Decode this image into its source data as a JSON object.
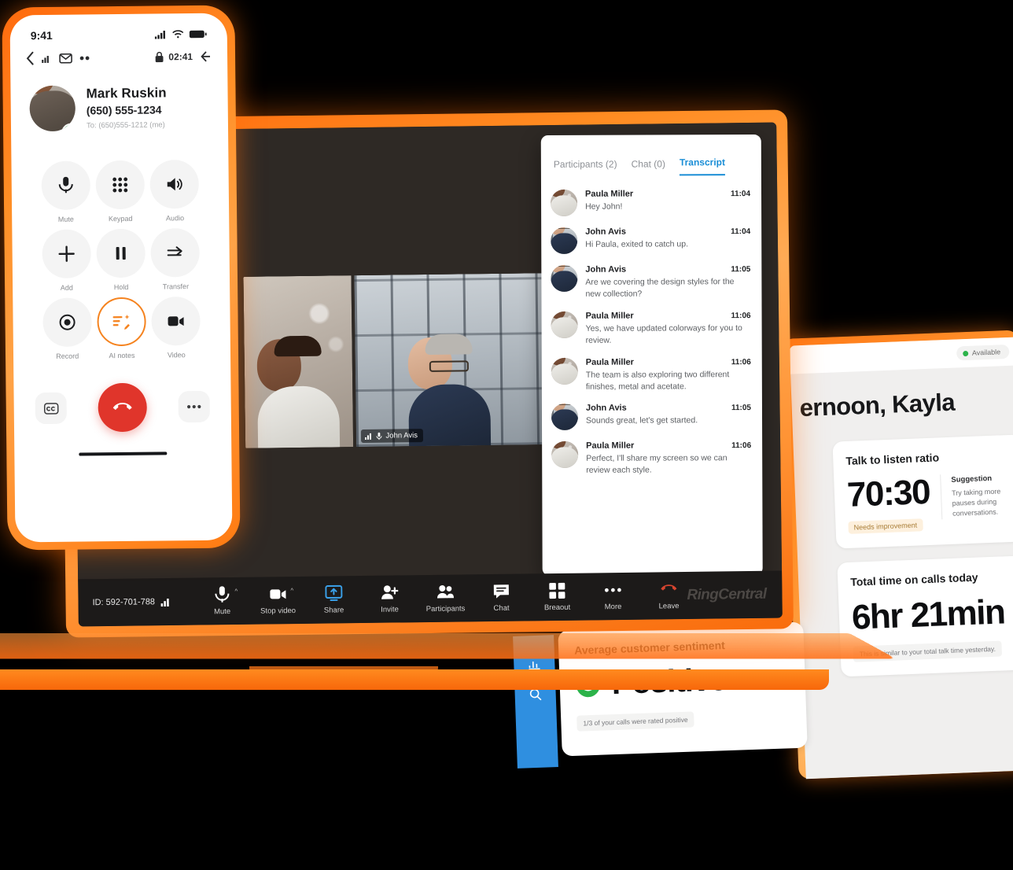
{
  "phone": {
    "status": {
      "time": "9:41",
      "signal_icon": "cellular-signal-icon",
      "wifi_icon": "wifi-icon",
      "battery_icon": "battery-icon"
    },
    "nav": {
      "back_icon": "chevron-left-icon",
      "encrypted_icon": "lock-icon",
      "call_timer": "02:41",
      "hd_icon": "call-quality-icon"
    },
    "caller": {
      "name": "Mark Ruskin",
      "number": "(650) 555-1234",
      "to_line": "To: (650)555-1212 (me)",
      "presence": "available"
    },
    "keys": [
      {
        "label": "Mute",
        "icon": "microphone-icon"
      },
      {
        "label": "Keypad",
        "icon": "dialpad-icon"
      },
      {
        "label": "Audio",
        "icon": "speaker-icon"
      },
      {
        "label": "Add",
        "icon": "plus-icon"
      },
      {
        "label": "Hold",
        "icon": "pause-icon"
      },
      {
        "label": "Transfer",
        "icon": "arrow-right-icon"
      },
      {
        "label": "Record",
        "icon": "record-icon"
      },
      {
        "label": "AI notes",
        "icon": "ai-notes-icon"
      },
      {
        "label": "Video",
        "icon": "video-camera-icon"
      }
    ],
    "bottom": {
      "captions_icon": "closed-captions-icon",
      "end_call_icon": "end-call-icon",
      "more_icon": "more-horizontal-icon"
    }
  },
  "meeting": {
    "tiles": [
      {
        "name": "",
        "person": "Paula Miller"
      },
      {
        "name": "John Avis",
        "person": "John Avis"
      }
    ],
    "panel": {
      "tabs": [
        {
          "label": "Participants (2)",
          "active": false
        },
        {
          "label": "Chat (0)",
          "active": false
        },
        {
          "label": "Transcript",
          "active": true
        }
      ],
      "accent": "#1b8ed6",
      "entries": [
        {
          "speaker": "Paula Miller",
          "time": "11:04",
          "text": "Hey John!",
          "who": "paula"
        },
        {
          "speaker": "John Avis",
          "time": "11:04",
          "text": "Hi Paula, exited to catch up.",
          "who": "john"
        },
        {
          "speaker": "John Avis",
          "time": "11:05",
          "text": "Are we covering the design styles for the new collection?",
          "who": "john"
        },
        {
          "speaker": "Paula Miller",
          "time": "11:06",
          "text": "Yes, we have updated colorways for you to review.",
          "who": "paula"
        },
        {
          "speaker": "Paula Miller",
          "time": "11:06",
          "text": "The team is also exploring two different finishes, metal and acetate.",
          "who": "paula"
        },
        {
          "speaker": "John Avis",
          "time": "11:05",
          "text": "Sounds great, let's get started.",
          "who": "john"
        },
        {
          "speaker": "Paula Miller",
          "time": "11:06",
          "text": "Perfect, I'll share my screen so we can review each style.",
          "who": "paula"
        }
      ]
    },
    "toolbar": {
      "meeting_id": "ID: 592-701-788",
      "signal_icon": "signal-bars-icon",
      "brand": "RingCentral",
      "items": [
        {
          "label": "Mute",
          "icon": "microphone-icon",
          "caret": true,
          "active": false
        },
        {
          "label": "Stop video",
          "icon": "video-camera-icon",
          "caret": true,
          "active": false
        },
        {
          "label": "Share",
          "icon": "share-screen-icon",
          "caret": false,
          "active": true
        },
        {
          "label": "Invite",
          "icon": "add-person-icon",
          "caret": false,
          "active": false
        },
        {
          "label": "Participants",
          "icon": "people-icon",
          "caret": false,
          "active": false
        },
        {
          "label": "Chat",
          "icon": "chat-bubble-icon",
          "caret": false,
          "active": false
        },
        {
          "label": "Breaout",
          "icon": "grid-icon",
          "caret": false,
          "active": false
        },
        {
          "label": "More",
          "icon": "more-horizontal-icon",
          "caret": false,
          "active": false
        },
        {
          "label": "Leave",
          "icon": "end-call-icon",
          "caret": false,
          "active": false
        }
      ]
    }
  },
  "dashboard": {
    "presence": {
      "label": "Available",
      "color": "#2cb34a"
    },
    "greeting": "ernoon, Kayla",
    "rail_icons": [
      "analytics-bar-chart-icon",
      "call-insights-icon"
    ],
    "cards": [
      {
        "title": "Talk to listen ratio",
        "value": "70:30",
        "tag": "Needs improvement",
        "suggestion_title": "Suggestion",
        "suggestion_text": "Try taking more pauses during conversations."
      },
      {
        "title": "Total time on calls today",
        "value": "6hr 21min",
        "note": "This is similar to your total talk time yesterday."
      }
    ],
    "sentiment_card": {
      "title": "Average customer sentiment",
      "icon": "smiley-face-icon",
      "value": "Positive",
      "note": "1/3 of your calls were rated positive"
    }
  }
}
